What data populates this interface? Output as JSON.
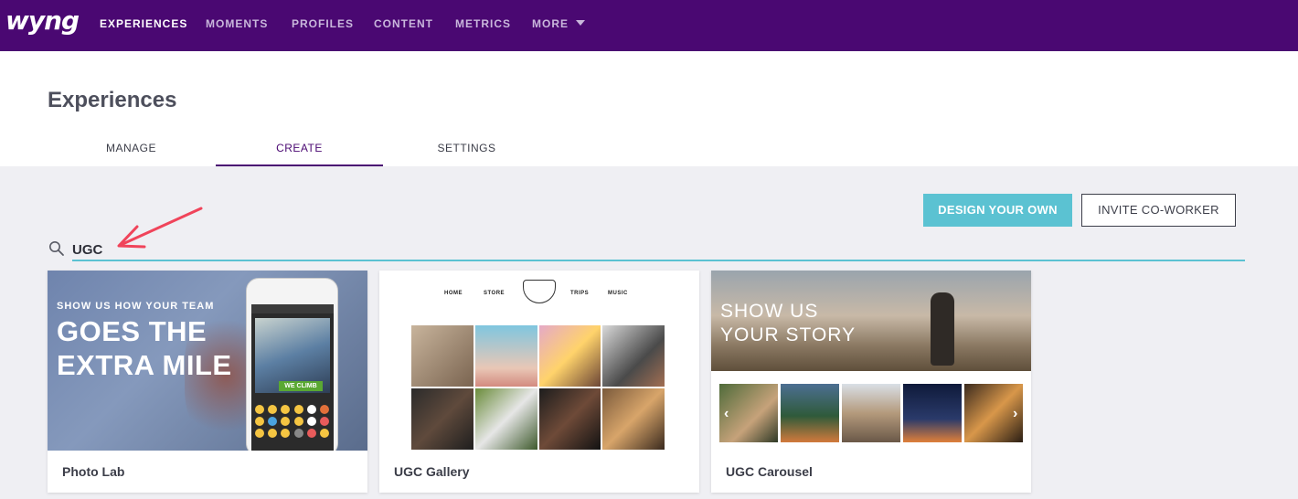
{
  "nav": {
    "logo": "wyng",
    "items": [
      {
        "label": "EXPERIENCES",
        "active": true
      },
      {
        "label": "MOMENTS",
        "active": false
      },
      {
        "label": "PROFILES",
        "active": false
      },
      {
        "label": "CONTENT",
        "active": false
      },
      {
        "label": "METRICS",
        "active": false
      },
      {
        "label": "MORE",
        "active": false
      }
    ],
    "more_icon": "caret-down-icon"
  },
  "page": {
    "title": "Experiences",
    "tabs": [
      {
        "label": "MANAGE",
        "active": false
      },
      {
        "label": "CREATE",
        "active": true
      },
      {
        "label": "SETTINGS",
        "active": false
      }
    ]
  },
  "actions": {
    "design_label": "DESIGN YOUR OWN",
    "invite_label": "INVITE CO-WORKER"
  },
  "search": {
    "value": "UGC",
    "icon": "search-icon",
    "annotation": "red-arrow-icon"
  },
  "cards": [
    {
      "label": "Photo Lab",
      "thumb_small": "SHOW US HOW YOUR TEAM",
      "thumb_big": "GOES THE EXTRA MILE",
      "phone_tag": "WE CLIMB"
    },
    {
      "label": "UGC Gallery",
      "thumb_nav": [
        "HOME",
        "STORE",
        "TRIPS",
        "MUSIC"
      ]
    },
    {
      "label": "UGC Carousel",
      "thumb_title": "SHOW US YOUR STORY"
    }
  ],
  "colors": {
    "nav_bg": "#4a0872",
    "accent": "#5bc2d2",
    "page_bg": "#efeff3",
    "annotation": "#f0445a"
  }
}
